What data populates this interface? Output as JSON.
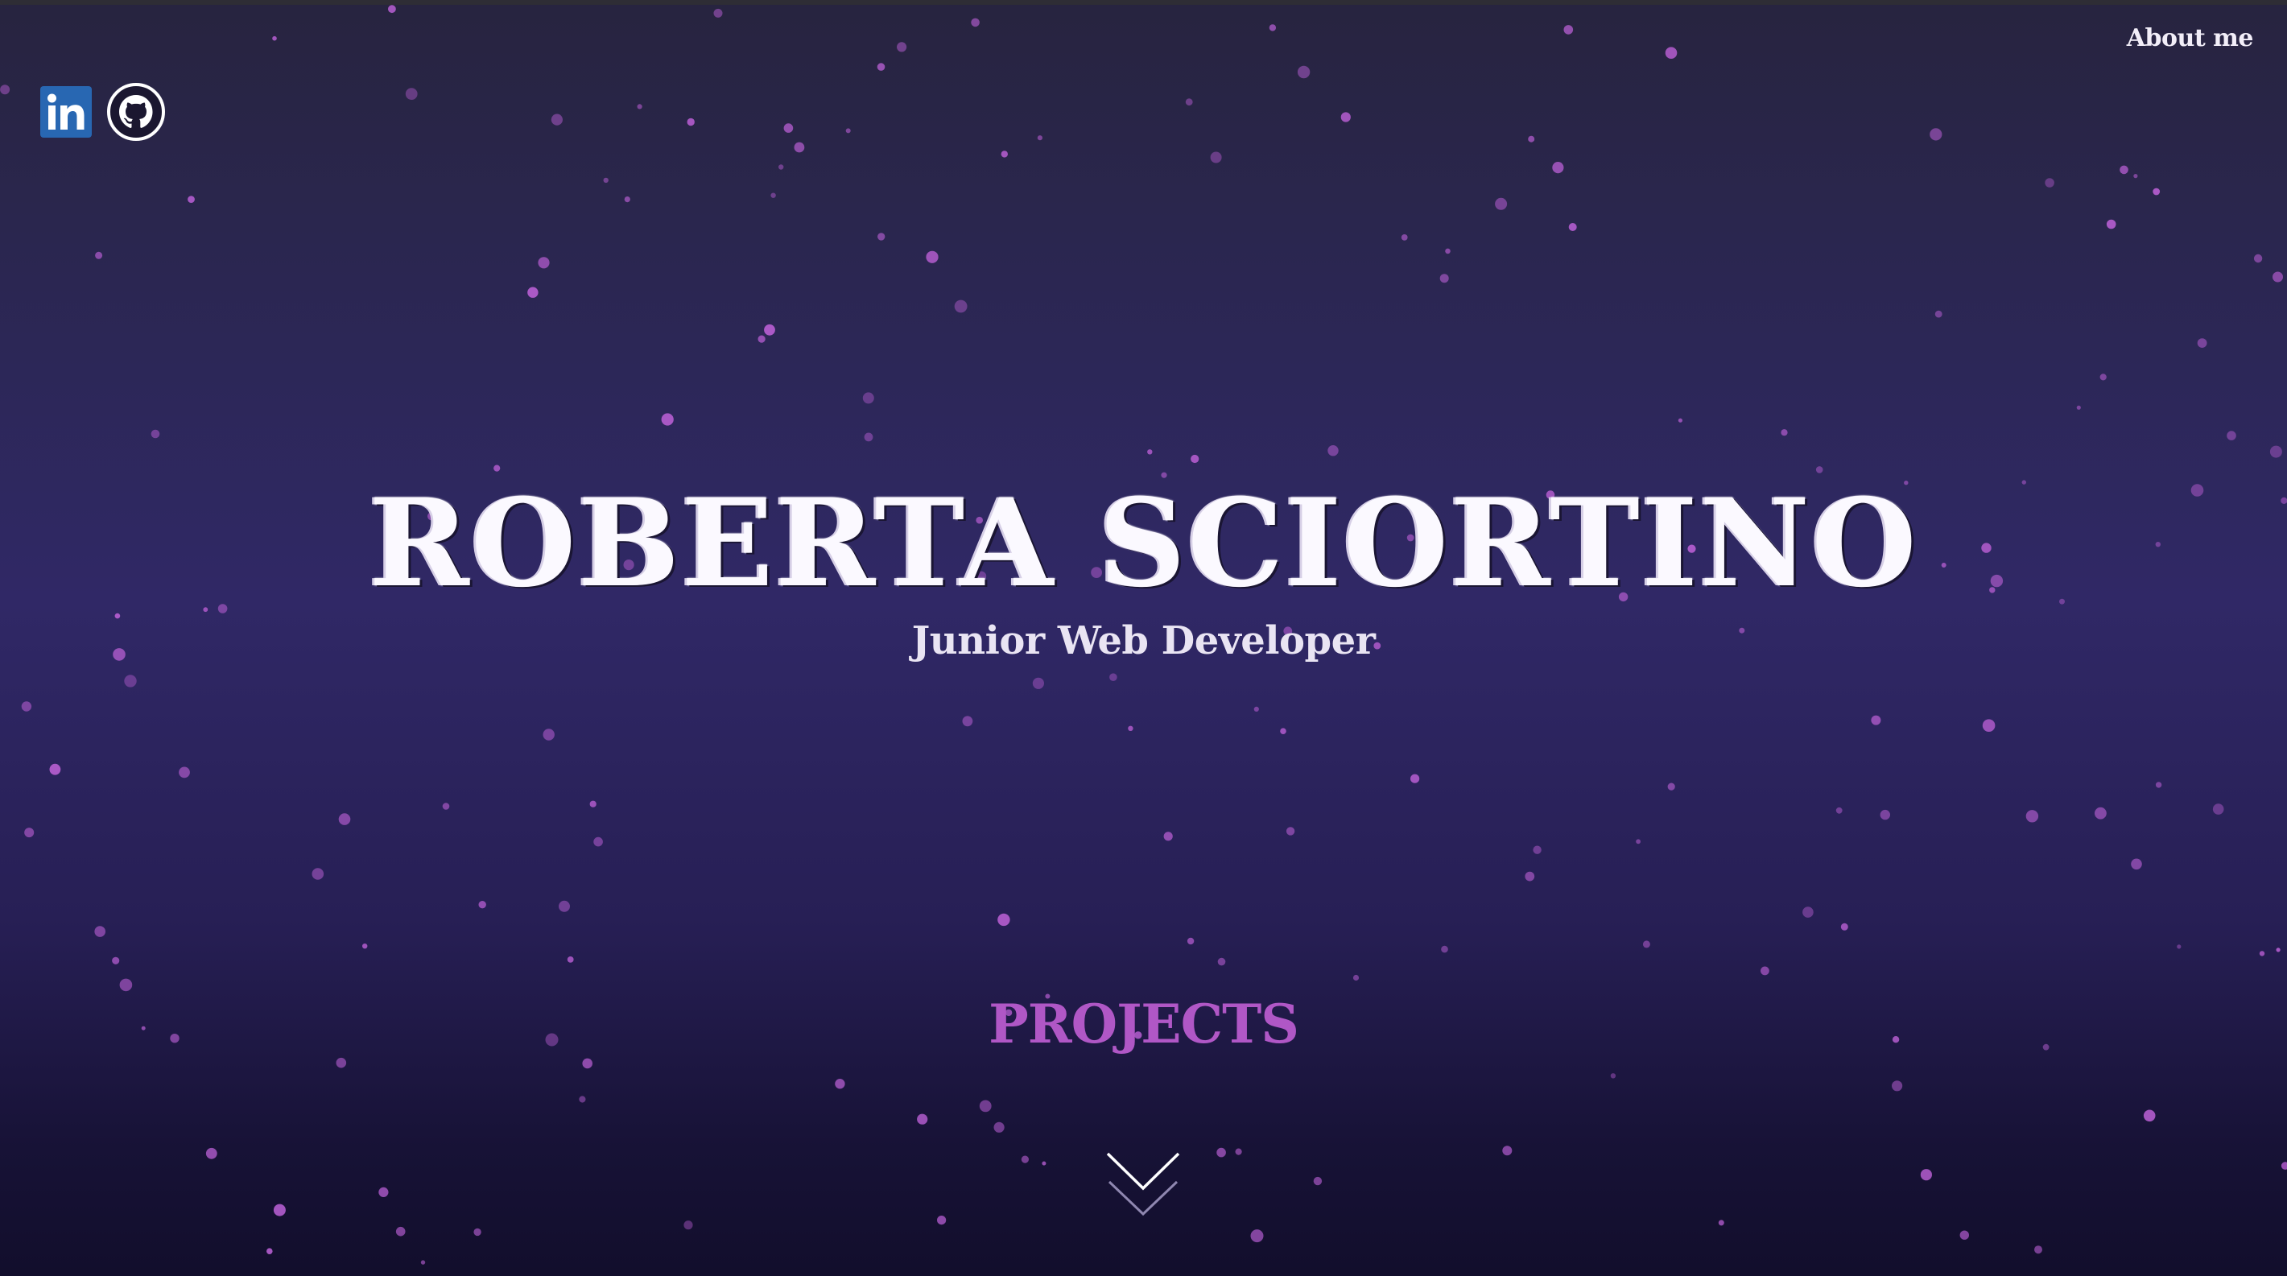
{
  "header": {
    "about_label": "About me"
  },
  "social": [
    {
      "icon": "linkedin-icon",
      "color": "#2867b2"
    },
    {
      "icon": "github-icon",
      "color": "#ffffff"
    }
  ],
  "hero": {
    "name": "ROBERTA SCIORTINO",
    "subtitle": "Junior Web Developer"
  },
  "projects_label": "PROJECTS",
  "scroll_icon": "chevron-down-icon",
  "colors": {
    "star": "#b25ccd",
    "accent": "#b057c6",
    "text": "#f2eef8"
  }
}
